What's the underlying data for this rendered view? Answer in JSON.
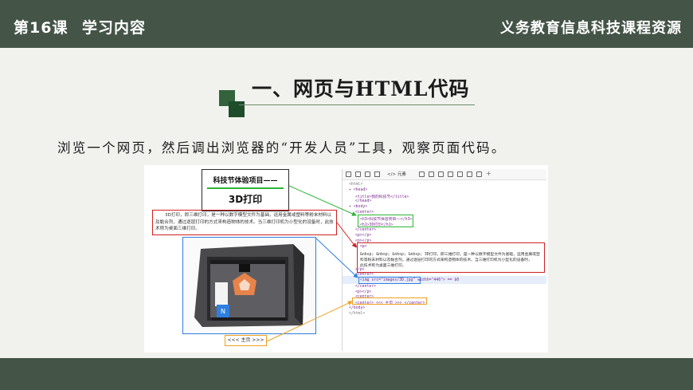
{
  "header": {
    "lesson": "第16课",
    "topic": "学习内容",
    "resource": "义务教育信息科技课程资源"
  },
  "section": {
    "heading": "一、网页与HTML代码",
    "intro": "浏览一个网页，然后调出浏览器的“开发人员”工具，观察页面代码。"
  },
  "webpage": {
    "title_line1": "科技节体验项目——",
    "title_line2": "3D打印",
    "paragraph": "3D打印，即三维打印，是一种以数字模型文件为基础，运用金属或塑料等粉末材料以及黏合剂，通过逐层打印的方式来构造物体的技术。当三维打印机为小型化的设备时，此技术称为桌面三维打印。",
    "nav": "<<< 主页 >>>"
  },
  "devtools": {
    "tab_label": "</> 元素",
    "lines": [
      "<html>",
      "▾ <head>",
      "<title>我的科技节</title>",
      "</head>",
      "▾ <body>",
      "<center>",
      "<h3>科技节体验项目——</h3>",
      "<h1>3D打印</h1>",
      "</center>",
      "<p></p>",
      "<p></p>",
      "▾ <p>",
      "&nbsp; &nbsp; &nbsp; &nbsp; 3D打印，即三维打印，是一种以数字模型文件为基础，运用金属或塑",
      "料等粉末材料以及黏合剂，通过逐层打印的方式来构造物体的技术。当三维打印机为小型化的设备时，",
      "此技术称为桌面三维打印。",
      "</p>",
      "<center>",
      "<img src=\"images/3D.jpg\" width=\"446\"> == $0",
      "</center>",
      "<p></p>",
      "<center>",
      "<center> <<< 主页 >>> </center>",
      "</body>",
      "</html>"
    ]
  },
  "colors": {
    "bar": "#445447",
    "background": "#f1f2ee",
    "green_marker": "#2db536",
    "red_marker": "#d02020",
    "blue_marker": "#2f7fe0",
    "orange_marker": "#f0a020"
  }
}
